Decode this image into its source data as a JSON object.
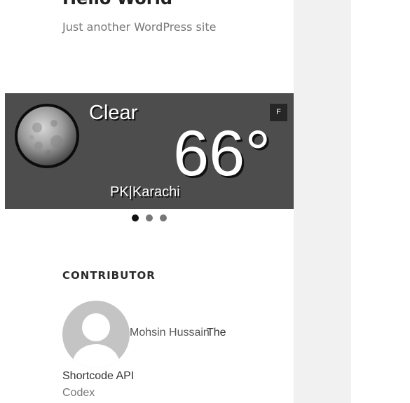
{
  "site": {
    "title": "Hello World",
    "tagline": "Just another WordPress site"
  },
  "weather": {
    "icon": "moon-icon",
    "condition": "Clear",
    "unit_toggle": "F",
    "temperature": "66°",
    "location": "PK|Karachi",
    "background_color": "#4d4d4d"
  },
  "slider": {
    "dot_count": 3,
    "active_index": 0
  },
  "contributor": {
    "heading": "CONTRIBUTOR",
    "name": "Mohsin Hussain",
    "name_suffix": "The",
    "line2": "Shortcode API",
    "line3": "Codex"
  }
}
